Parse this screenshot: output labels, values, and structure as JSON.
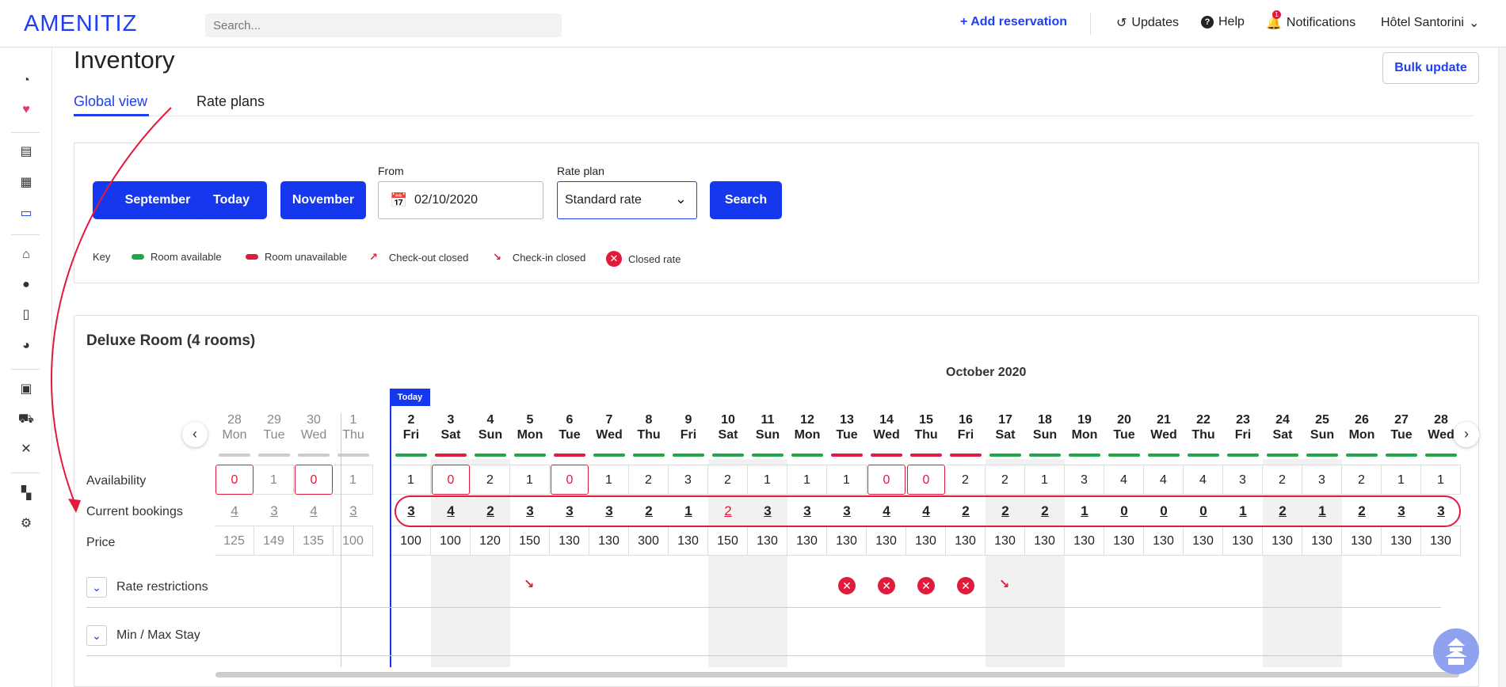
{
  "topbar": {
    "logo": "AMENITIZ",
    "search_placeholder": "Search...",
    "add_reservation": "+ Add reservation",
    "updates": "Updates",
    "help": "Help",
    "notifications": "Notifications",
    "notifications_badge": "1",
    "hotel": "Hôtel Santorini"
  },
  "page": {
    "title": "Inventory",
    "bulk_update": "Bulk update",
    "tabs": [
      "Global view",
      "Rate plans"
    ]
  },
  "filters": {
    "prev_month": "September",
    "today": "Today",
    "next_month": "November",
    "from_label": "From",
    "from_value": "02/10/2020",
    "rate_label": "Rate plan",
    "rate_value": "Standard rate",
    "search": "Search"
  },
  "key": {
    "label": "Key",
    "items": [
      "Room available",
      "Room unavailable",
      "Check-out closed",
      "Check-in closed",
      "Closed rate"
    ],
    "colors": {
      "available": "#1fa84a",
      "unavailable": "#e21b3c",
      "accent": "#1537ee"
    }
  },
  "room": {
    "title": "Deluxe Room (4 rooms)",
    "month": "October 2020",
    "today_badge": "Today",
    "row_labels": [
      "Availability",
      "Current bookings",
      "Price"
    ],
    "sections": [
      "Rate restrictions",
      "Min / Max Stay"
    ],
    "days": [
      {
        "d": "28",
        "w": "Mon",
        "avail": "0",
        "book": "4",
        "price": "125",
        "past": true,
        "bar": "grey"
      },
      {
        "d": "29",
        "w": "Tue",
        "avail": "1",
        "book": "3",
        "price": "149",
        "past": true,
        "bar": "grey"
      },
      {
        "d": "30",
        "w": "Wed",
        "avail": "0",
        "book": "4",
        "price": "135",
        "past": true,
        "bar": "grey"
      },
      {
        "d": "1",
        "w": "Thu",
        "avail": "1",
        "book": "3",
        "price": "100",
        "past": true,
        "bar": "grey"
      },
      {
        "d": "2",
        "w": "Fri",
        "avail": "1",
        "book": "3",
        "price": "100",
        "bar": "green"
      },
      {
        "d": "3",
        "w": "Sat",
        "avail": "0",
        "book": "4",
        "price": "100",
        "bar": "red",
        "shade": true
      },
      {
        "d": "4",
        "w": "Sun",
        "avail": "2",
        "book": "2",
        "price": "120",
        "bar": "green",
        "shade": true
      },
      {
        "d": "5",
        "w": "Mon",
        "avail": "1",
        "book": "3",
        "price": "150",
        "bar": "green",
        "restr": "checkin"
      },
      {
        "d": "6",
        "w": "Tue",
        "avail": "0",
        "book": "3",
        "price": "130",
        "bar": "red"
      },
      {
        "d": "7",
        "w": "Wed",
        "avail": "1",
        "book": "3",
        "price": "130",
        "bar": "green"
      },
      {
        "d": "8",
        "w": "Thu",
        "avail": "2",
        "book": "2",
        "price": "300",
        "bar": "green"
      },
      {
        "d": "9",
        "w": "Fri",
        "avail": "3",
        "book": "1",
        "price": "130",
        "bar": "green"
      },
      {
        "d": "10",
        "w": "Sat",
        "avail": "2",
        "book": "2",
        "price": "150",
        "bar": "green",
        "shade": true,
        "redbook": true
      },
      {
        "d": "11",
        "w": "Sun",
        "avail": "1",
        "book": "3",
        "price": "130",
        "bar": "green",
        "shade": true
      },
      {
        "d": "12",
        "w": "Mon",
        "avail": "1",
        "book": "3",
        "price": "130",
        "bar": "green"
      },
      {
        "d": "13",
        "w": "Tue",
        "avail": "1",
        "book": "3",
        "price": "130",
        "bar": "red",
        "restr": "closed"
      },
      {
        "d": "14",
        "w": "Wed",
        "avail": "0",
        "book": "4",
        "price": "130",
        "bar": "red",
        "restr": "closed"
      },
      {
        "d": "15",
        "w": "Thu",
        "avail": "0",
        "book": "4",
        "price": "130",
        "bar": "red",
        "restr": "closed"
      },
      {
        "d": "16",
        "w": "Fri",
        "avail": "2",
        "book": "2",
        "price": "130",
        "bar": "red",
        "restr": "closed"
      },
      {
        "d": "17",
        "w": "Sat",
        "avail": "2",
        "book": "2",
        "price": "130",
        "bar": "green",
        "shade": true,
        "restr": "checkin"
      },
      {
        "d": "18",
        "w": "Sun",
        "avail": "1",
        "book": "2",
        "price": "130",
        "bar": "green",
        "shade": true
      },
      {
        "d": "19",
        "w": "Mon",
        "avail": "3",
        "book": "1",
        "price": "130",
        "bar": "green"
      },
      {
        "d": "20",
        "w": "Tue",
        "avail": "4",
        "book": "0",
        "price": "130",
        "bar": "green"
      },
      {
        "d": "21",
        "w": "Wed",
        "avail": "4",
        "book": "0",
        "price": "130",
        "bar": "green"
      },
      {
        "d": "22",
        "w": "Thu",
        "avail": "4",
        "book": "0",
        "price": "130",
        "bar": "green"
      },
      {
        "d": "23",
        "w": "Fri",
        "avail": "3",
        "book": "1",
        "price": "130",
        "bar": "green"
      },
      {
        "d": "24",
        "w": "Sat",
        "avail": "2",
        "book": "2",
        "price": "130",
        "bar": "green",
        "shade": true
      },
      {
        "d": "25",
        "w": "Sun",
        "avail": "3",
        "book": "1",
        "price": "130",
        "bar": "green",
        "shade": true
      },
      {
        "d": "26",
        "w": "Mon",
        "avail": "2",
        "book": "2",
        "price": "130",
        "bar": "green"
      },
      {
        "d": "27",
        "w": "Tue",
        "avail": "1",
        "book": "3",
        "price": "130",
        "bar": "green"
      },
      {
        "d": "28",
        "w": "Wed",
        "avail": "1",
        "book": "3",
        "price": "130",
        "bar": "green"
      }
    ]
  }
}
